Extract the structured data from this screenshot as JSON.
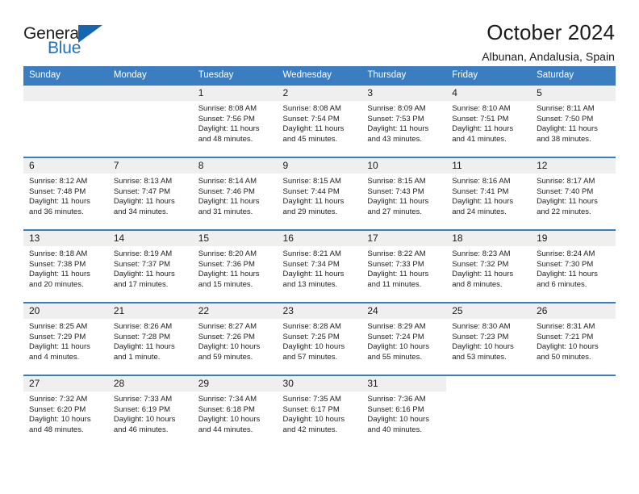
{
  "brand": {
    "name_part1": "General",
    "name_part2": "Blue",
    "flag_icon": "flag-icon"
  },
  "header": {
    "title": "October 2024",
    "subtitle": "Albunan, Andalusia, Spain"
  },
  "colors": {
    "header_blue": "#3b7dc1",
    "daynum_gray": "#efefef",
    "brand_blue": "#1f6fc0",
    "flag_blue": "#1565b0"
  },
  "weekdays": [
    "Sunday",
    "Monday",
    "Tuesday",
    "Wednesday",
    "Thursday",
    "Friday",
    "Saturday"
  ],
  "labels": {
    "sunrise": "Sunrise:",
    "sunset": "Sunset:",
    "daylight": "Daylight:"
  },
  "weeks": [
    [
      {
        "day": "",
        "empty": true
      },
      {
        "day": "",
        "empty": true
      },
      {
        "day": "1",
        "sunrise": "Sunrise: 8:08 AM",
        "sunset": "Sunset: 7:56 PM",
        "daylight": "Daylight: 11 hours and 48 minutes."
      },
      {
        "day": "2",
        "sunrise": "Sunrise: 8:08 AM",
        "sunset": "Sunset: 7:54 PM",
        "daylight": "Daylight: 11 hours and 45 minutes."
      },
      {
        "day": "3",
        "sunrise": "Sunrise: 8:09 AM",
        "sunset": "Sunset: 7:53 PM",
        "daylight": "Daylight: 11 hours and 43 minutes."
      },
      {
        "day": "4",
        "sunrise": "Sunrise: 8:10 AM",
        "sunset": "Sunset: 7:51 PM",
        "daylight": "Daylight: 11 hours and 41 minutes."
      },
      {
        "day": "5",
        "sunrise": "Sunrise: 8:11 AM",
        "sunset": "Sunset: 7:50 PM",
        "daylight": "Daylight: 11 hours and 38 minutes."
      }
    ],
    [
      {
        "day": "6",
        "sunrise": "Sunrise: 8:12 AM",
        "sunset": "Sunset: 7:48 PM",
        "daylight": "Daylight: 11 hours and 36 minutes."
      },
      {
        "day": "7",
        "sunrise": "Sunrise: 8:13 AM",
        "sunset": "Sunset: 7:47 PM",
        "daylight": "Daylight: 11 hours and 34 minutes."
      },
      {
        "day": "8",
        "sunrise": "Sunrise: 8:14 AM",
        "sunset": "Sunset: 7:46 PM",
        "daylight": "Daylight: 11 hours and 31 minutes."
      },
      {
        "day": "9",
        "sunrise": "Sunrise: 8:15 AM",
        "sunset": "Sunset: 7:44 PM",
        "daylight": "Daylight: 11 hours and 29 minutes."
      },
      {
        "day": "10",
        "sunrise": "Sunrise: 8:15 AM",
        "sunset": "Sunset: 7:43 PM",
        "daylight": "Daylight: 11 hours and 27 minutes."
      },
      {
        "day": "11",
        "sunrise": "Sunrise: 8:16 AM",
        "sunset": "Sunset: 7:41 PM",
        "daylight": "Daylight: 11 hours and 24 minutes."
      },
      {
        "day": "12",
        "sunrise": "Sunrise: 8:17 AM",
        "sunset": "Sunset: 7:40 PM",
        "daylight": "Daylight: 11 hours and 22 minutes."
      }
    ],
    [
      {
        "day": "13",
        "sunrise": "Sunrise: 8:18 AM",
        "sunset": "Sunset: 7:38 PM",
        "daylight": "Daylight: 11 hours and 20 minutes."
      },
      {
        "day": "14",
        "sunrise": "Sunrise: 8:19 AM",
        "sunset": "Sunset: 7:37 PM",
        "daylight": "Daylight: 11 hours and 17 minutes."
      },
      {
        "day": "15",
        "sunrise": "Sunrise: 8:20 AM",
        "sunset": "Sunset: 7:36 PM",
        "daylight": "Daylight: 11 hours and 15 minutes."
      },
      {
        "day": "16",
        "sunrise": "Sunrise: 8:21 AM",
        "sunset": "Sunset: 7:34 PM",
        "daylight": "Daylight: 11 hours and 13 minutes."
      },
      {
        "day": "17",
        "sunrise": "Sunrise: 8:22 AM",
        "sunset": "Sunset: 7:33 PM",
        "daylight": "Daylight: 11 hours and 11 minutes."
      },
      {
        "day": "18",
        "sunrise": "Sunrise: 8:23 AM",
        "sunset": "Sunset: 7:32 PM",
        "daylight": "Daylight: 11 hours and 8 minutes."
      },
      {
        "day": "19",
        "sunrise": "Sunrise: 8:24 AM",
        "sunset": "Sunset: 7:30 PM",
        "daylight": "Daylight: 11 hours and 6 minutes."
      }
    ],
    [
      {
        "day": "20",
        "sunrise": "Sunrise: 8:25 AM",
        "sunset": "Sunset: 7:29 PM",
        "daylight": "Daylight: 11 hours and 4 minutes."
      },
      {
        "day": "21",
        "sunrise": "Sunrise: 8:26 AM",
        "sunset": "Sunset: 7:28 PM",
        "daylight": "Daylight: 11 hours and 1 minute."
      },
      {
        "day": "22",
        "sunrise": "Sunrise: 8:27 AM",
        "sunset": "Sunset: 7:26 PM",
        "daylight": "Daylight: 10 hours and 59 minutes."
      },
      {
        "day": "23",
        "sunrise": "Sunrise: 8:28 AM",
        "sunset": "Sunset: 7:25 PM",
        "daylight": "Daylight: 10 hours and 57 minutes."
      },
      {
        "day": "24",
        "sunrise": "Sunrise: 8:29 AM",
        "sunset": "Sunset: 7:24 PM",
        "daylight": "Daylight: 10 hours and 55 minutes."
      },
      {
        "day": "25",
        "sunrise": "Sunrise: 8:30 AM",
        "sunset": "Sunset: 7:23 PM",
        "daylight": "Daylight: 10 hours and 53 minutes."
      },
      {
        "day": "26",
        "sunrise": "Sunrise: 8:31 AM",
        "sunset": "Sunset: 7:21 PM",
        "daylight": "Daylight: 10 hours and 50 minutes."
      }
    ],
    [
      {
        "day": "27",
        "sunrise": "Sunrise: 7:32 AM",
        "sunset": "Sunset: 6:20 PM",
        "daylight": "Daylight: 10 hours and 48 minutes."
      },
      {
        "day": "28",
        "sunrise": "Sunrise: 7:33 AM",
        "sunset": "Sunset: 6:19 PM",
        "daylight": "Daylight: 10 hours and 46 minutes."
      },
      {
        "day": "29",
        "sunrise": "Sunrise: 7:34 AM",
        "sunset": "Sunset: 6:18 PM",
        "daylight": "Daylight: 10 hours and 44 minutes."
      },
      {
        "day": "30",
        "sunrise": "Sunrise: 7:35 AM",
        "sunset": "Sunset: 6:17 PM",
        "daylight": "Daylight: 10 hours and 42 minutes."
      },
      {
        "day": "31",
        "sunrise": "Sunrise: 7:36 AM",
        "sunset": "Sunset: 6:16 PM",
        "daylight": "Daylight: 10 hours and 40 minutes."
      },
      {
        "day": "",
        "blank": true
      },
      {
        "day": "",
        "blank": true
      }
    ]
  ]
}
